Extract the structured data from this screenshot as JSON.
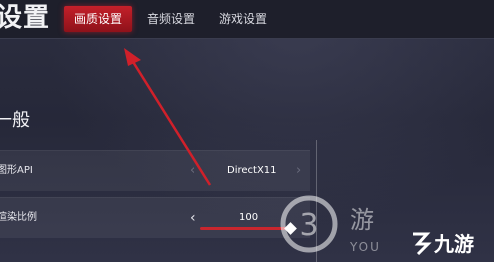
{
  "header": {
    "title": "设置",
    "tabs": [
      {
        "label": "画质设置",
        "active": true
      },
      {
        "label": "音频设置",
        "active": false
      },
      {
        "label": "游戏设置",
        "active": false
      }
    ]
  },
  "section": {
    "title": "一般"
  },
  "rows": [
    {
      "label": "图形API",
      "value": "DirectX11"
    },
    {
      "label": "渲染比例",
      "value": "100"
    }
  ],
  "watermarks": {
    "main_text": "游",
    "sub_text": "YOU",
    "brand_text": "九游"
  },
  "colors": {
    "accent": "#c4202a",
    "arrow": "#d0202a"
  }
}
